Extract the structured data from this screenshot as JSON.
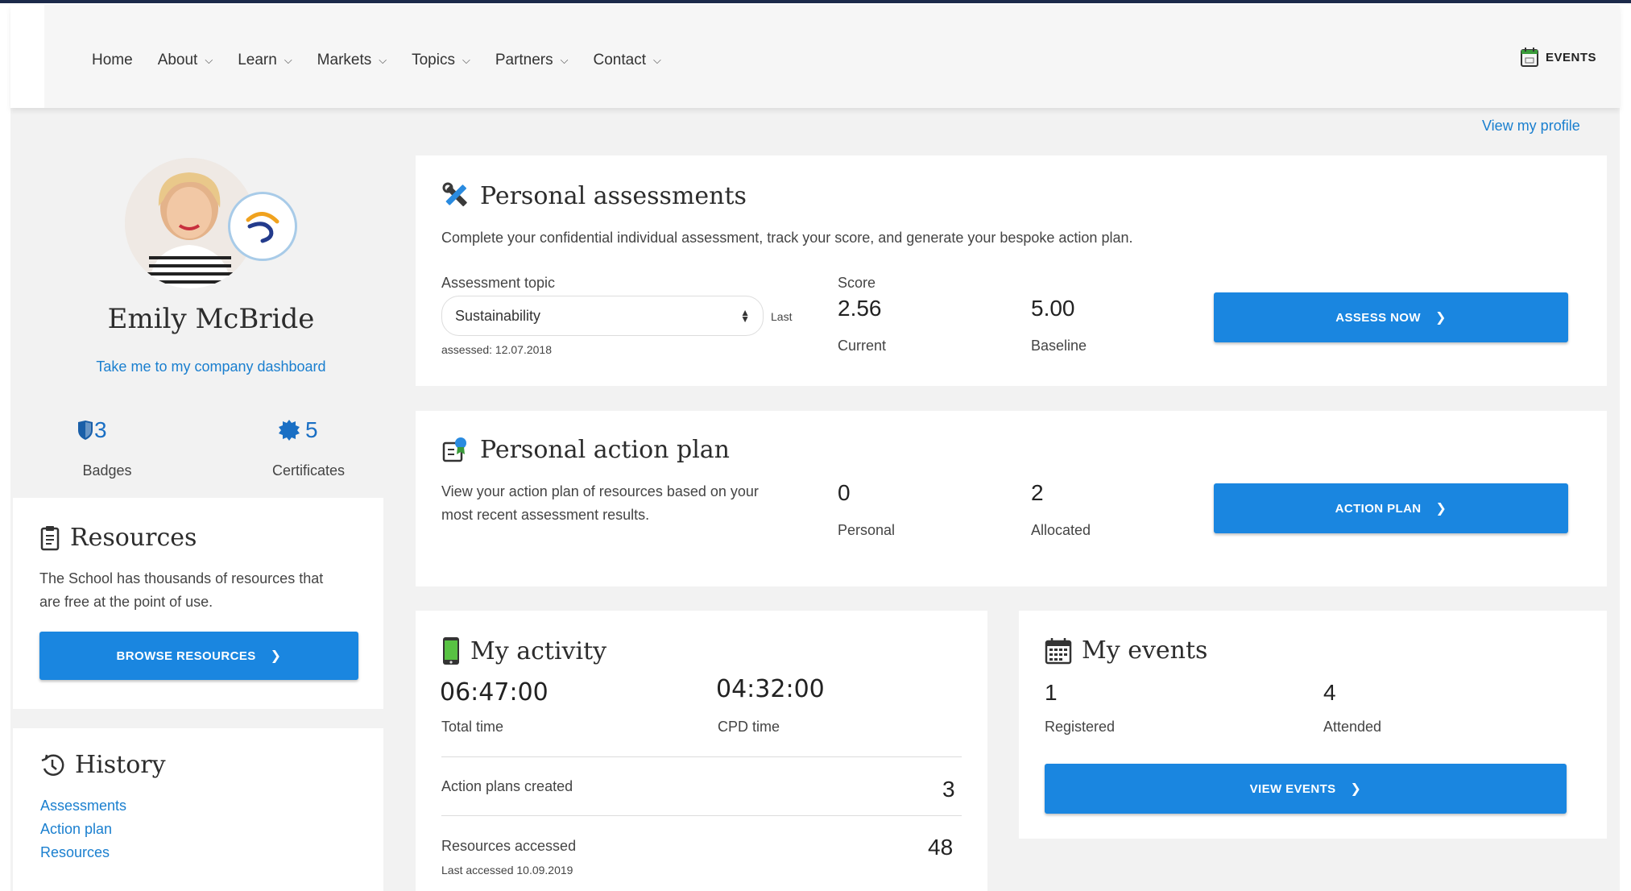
{
  "nav": {
    "items": [
      {
        "label": "Home",
        "dropdown": false
      },
      {
        "label": "About",
        "dropdown": true
      },
      {
        "label": "Learn",
        "dropdown": true
      },
      {
        "label": "Markets",
        "dropdown": true
      },
      {
        "label": "Topics",
        "dropdown": true
      },
      {
        "label": "Partners",
        "dropdown": true
      },
      {
        "label": "Contact",
        "dropdown": true
      }
    ],
    "events_label": "EVENTS"
  },
  "view_profile_label": "View my profile",
  "profile": {
    "name": "Emily McBride",
    "dashboard_link": "Take me to my company dashboard",
    "badges_count": "3",
    "badges_label": "Badges",
    "certificates_count": "5",
    "certificates_label": "Certificates"
  },
  "resources": {
    "title": "Resources",
    "description_line1": "The School has thousands of resources that",
    "description_line2": "are free at the point of use.",
    "button_label": "BROWSE RESOURCES"
  },
  "history": {
    "title": "History",
    "links": [
      "Assessments",
      "Action plan",
      "Resources"
    ]
  },
  "assessments": {
    "title": "Personal assessments",
    "description": "Complete your confidential individual assessment, track your score, and generate your bespoke action plan.",
    "topic_label": "Assessment topic",
    "topic_value": "Sustainability",
    "last_label": "Last",
    "assessed_label": "assessed: 12.07.2018",
    "score_label": "Score",
    "current_value": "2.56",
    "current_label": "Current",
    "baseline_value": "5.00",
    "baseline_label": "Baseline",
    "button_label": "ASSESS NOW"
  },
  "action_plan": {
    "title": "Personal action plan",
    "description_line1": "View your action plan of resources based on your",
    "description_line2": "most recent assessment results.",
    "personal_value": "0",
    "personal_label": "Personal",
    "allocated_value": "2",
    "allocated_label": "Allocated",
    "button_label": "ACTION PLAN"
  },
  "activity": {
    "title": "My activity",
    "total_time": "06:47:00",
    "total_time_label": "Total time",
    "cpd_time": "04:32:00",
    "cpd_time_label": "CPD time",
    "action_plans_label": "Action plans created",
    "action_plans_value": "3",
    "resources_label": "Resources accessed",
    "resources_value": "48",
    "last_accessed": "Last accessed 10.09.2019"
  },
  "events": {
    "title": "My events",
    "registered_value": "1",
    "registered_label": "Registered",
    "attended_value": "4",
    "attended_label": "Attended",
    "button_label": "VIEW EVENTS"
  },
  "colors": {
    "primary_button": "#1a86e0",
    "link": "#1a7fcf",
    "badge_icon": "#1a6fc4",
    "background": "#f2f2f2"
  }
}
